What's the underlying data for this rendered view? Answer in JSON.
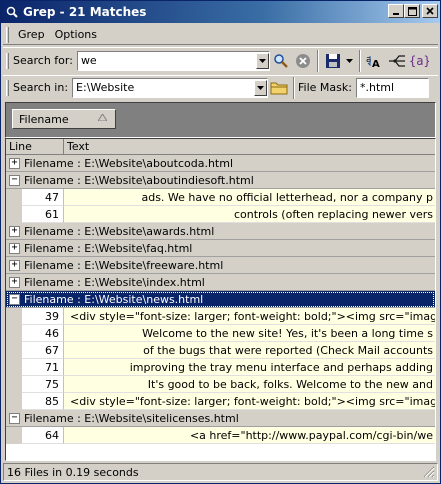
{
  "window": {
    "title": "Grep - 21 Matches"
  },
  "menu": [
    {
      "label": "Grep"
    },
    {
      "label": "Options"
    }
  ],
  "search": {
    "label": "Search for:",
    "value": "we"
  },
  "location": {
    "label": "Search in:",
    "value": "E:\\Website",
    "mask_label": "File Mask:",
    "mask_value": "*.html"
  },
  "group": {
    "chip_label": "Filename"
  },
  "grid": {
    "headers": {
      "line": "Line",
      "text": "Text"
    },
    "groups": [
      {
        "title": "Filename : E:\\Website\\aboutcoda.html",
        "expanded": false,
        "rows": []
      },
      {
        "title": "Filename : E:\\Website\\aboutindiesoft.html",
        "expanded": true,
        "rows": [
          {
            "line": "47",
            "text": "ads. We have no official letterhead, nor a company p"
          },
          {
            "line": "61",
            "text": "controls (often replacing newer vers"
          }
        ]
      },
      {
        "title": "Filename : E:\\Website\\awards.html",
        "expanded": false,
        "rows": []
      },
      {
        "title": "Filename : E:\\Website\\faq.html",
        "expanded": false,
        "rows": []
      },
      {
        "title": "Filename : E:\\Website\\freeware.html",
        "expanded": false,
        "rows": []
      },
      {
        "title": "Filename : E:\\Website\\index.html",
        "expanded": false,
        "rows": []
      },
      {
        "title": "Filename : E:\\Website\\news.html",
        "expanded": true,
        "selected": true,
        "rows": [
          {
            "line": "39",
            "text": "<div style=\"font-size: larger; font-weight: bold;\"><img src=\"imag"
          },
          {
            "line": "46",
            "text": "Welcome to the new site! Yes, it's been a long time s"
          },
          {
            "line": "67",
            "text": "of the bugs that were reported (Check Mail accounts"
          },
          {
            "line": "71",
            "text": "improving the tray menu interface and perhaps adding"
          },
          {
            "line": "75",
            "text": "It's good to be back, folks. Welcome to the new and"
          },
          {
            "line": "85",
            "text": "<div style=\"font-size: larger; font-weight: bold;\"><img src=\"imag"
          }
        ]
      },
      {
        "title": "Filename : E:\\Website\\sitelicenses.html",
        "expanded": true,
        "rows": [
          {
            "line": "64",
            "text": "<a href=\"http://www.paypal.com/cgi-bin/we"
          }
        ]
      }
    ]
  },
  "status": {
    "text": "16 Files in 0.19 seconds"
  },
  "icons": [
    "app-icon",
    "minimize-icon",
    "maximize-icon",
    "close-icon",
    "search-go-icon",
    "clear-icon",
    "save-icon",
    "case-icon",
    "regex-icon",
    "braces-icon",
    "folder-icon",
    "sort-arrow-icon",
    "expand-icon",
    "collapse-icon",
    "resize-grip-icon"
  ],
  "colors": {
    "title_start": "#0a246a",
    "title_end": "#a6caf0",
    "selected_row": "#0a246a",
    "text_cell_bg": "#ffffe1",
    "chrome": "#d4d0c8"
  }
}
